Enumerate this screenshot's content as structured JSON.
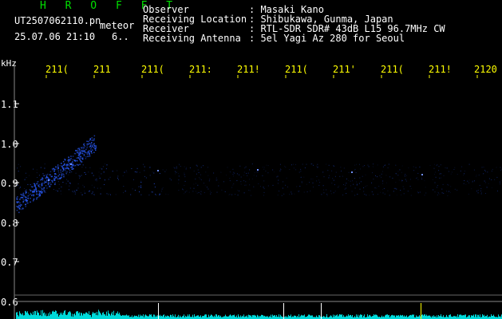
{
  "app": {
    "title": "H R O F F T",
    "filename": "UT2507062110.pn",
    "mode": "meteor",
    "datetime": "25.07.06 21:10",
    "count": "6.."
  },
  "header": {
    "rows": [
      {
        "label": "Observer",
        "value": ": Masaki Kano"
      },
      {
        "label": "Receiving Location",
        "value": ": Shibukawa, Gunma, Japan"
      },
      {
        "label": "Receiver",
        "value": ": RTL-SDR SDR# 43dB L15 96.7MHz CW"
      },
      {
        "label": "Receiving Antenna",
        "value": ": 5el Yagi Az 280 for Seoul"
      }
    ]
  },
  "axes": {
    "y_unit": "kHz",
    "y_ticks": [
      "1.1",
      "1.0",
      "0.9",
      "0.8",
      "0.7",
      "0.6"
    ],
    "x_ticks": [
      "211(",
      "211",
      "211(",
      "211:",
      "211!",
      "211(",
      "211'",
      "211(",
      "211!",
      "2120"
    ]
  },
  "colors": {
    "title": "#00e000",
    "text": "#ffffff",
    "tick": "#ffff00",
    "signal": "#2a5cff",
    "level": "#00ffff"
  }
}
